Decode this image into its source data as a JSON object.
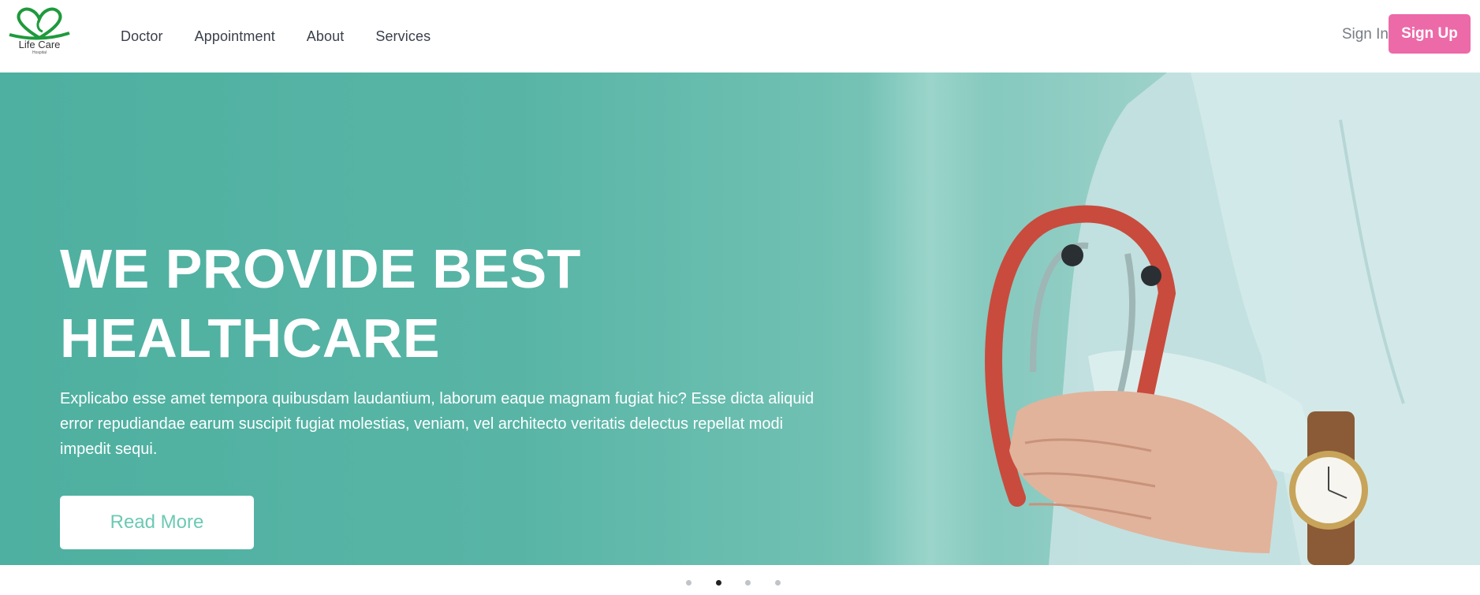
{
  "logo": {
    "name": "Life Care",
    "subtitle": "Hospital",
    "icon": "heart-ribbon-logo",
    "color": "#1e9a3c"
  },
  "nav": {
    "items": [
      {
        "label": "Doctor"
      },
      {
        "label": "Appointment"
      },
      {
        "label": "About"
      },
      {
        "label": "Services"
      }
    ],
    "sign_in": "Sign In",
    "sign_up": "Sign Up"
  },
  "hero": {
    "title": "WE PROVIDE BEST HEALTHCARE",
    "text": "Explicabo esse amet tempora quibusdam laudantium, laborum eaque magnam fugiat hic? Esse dicta aliquid error repudiandae earum suscipit fugiat molestias, veniam, vel architecto veritatis delectus repellat modi impedit sequi.",
    "button": "Read More",
    "image": "doctor-with-stethoscope-photo"
  },
  "carousel": {
    "slide_count": 4,
    "active_index": 1
  },
  "colors": {
    "accent": "#ec6aa8",
    "hero_teal": "#4eb0a0",
    "button_text": "#6cc9b4"
  }
}
